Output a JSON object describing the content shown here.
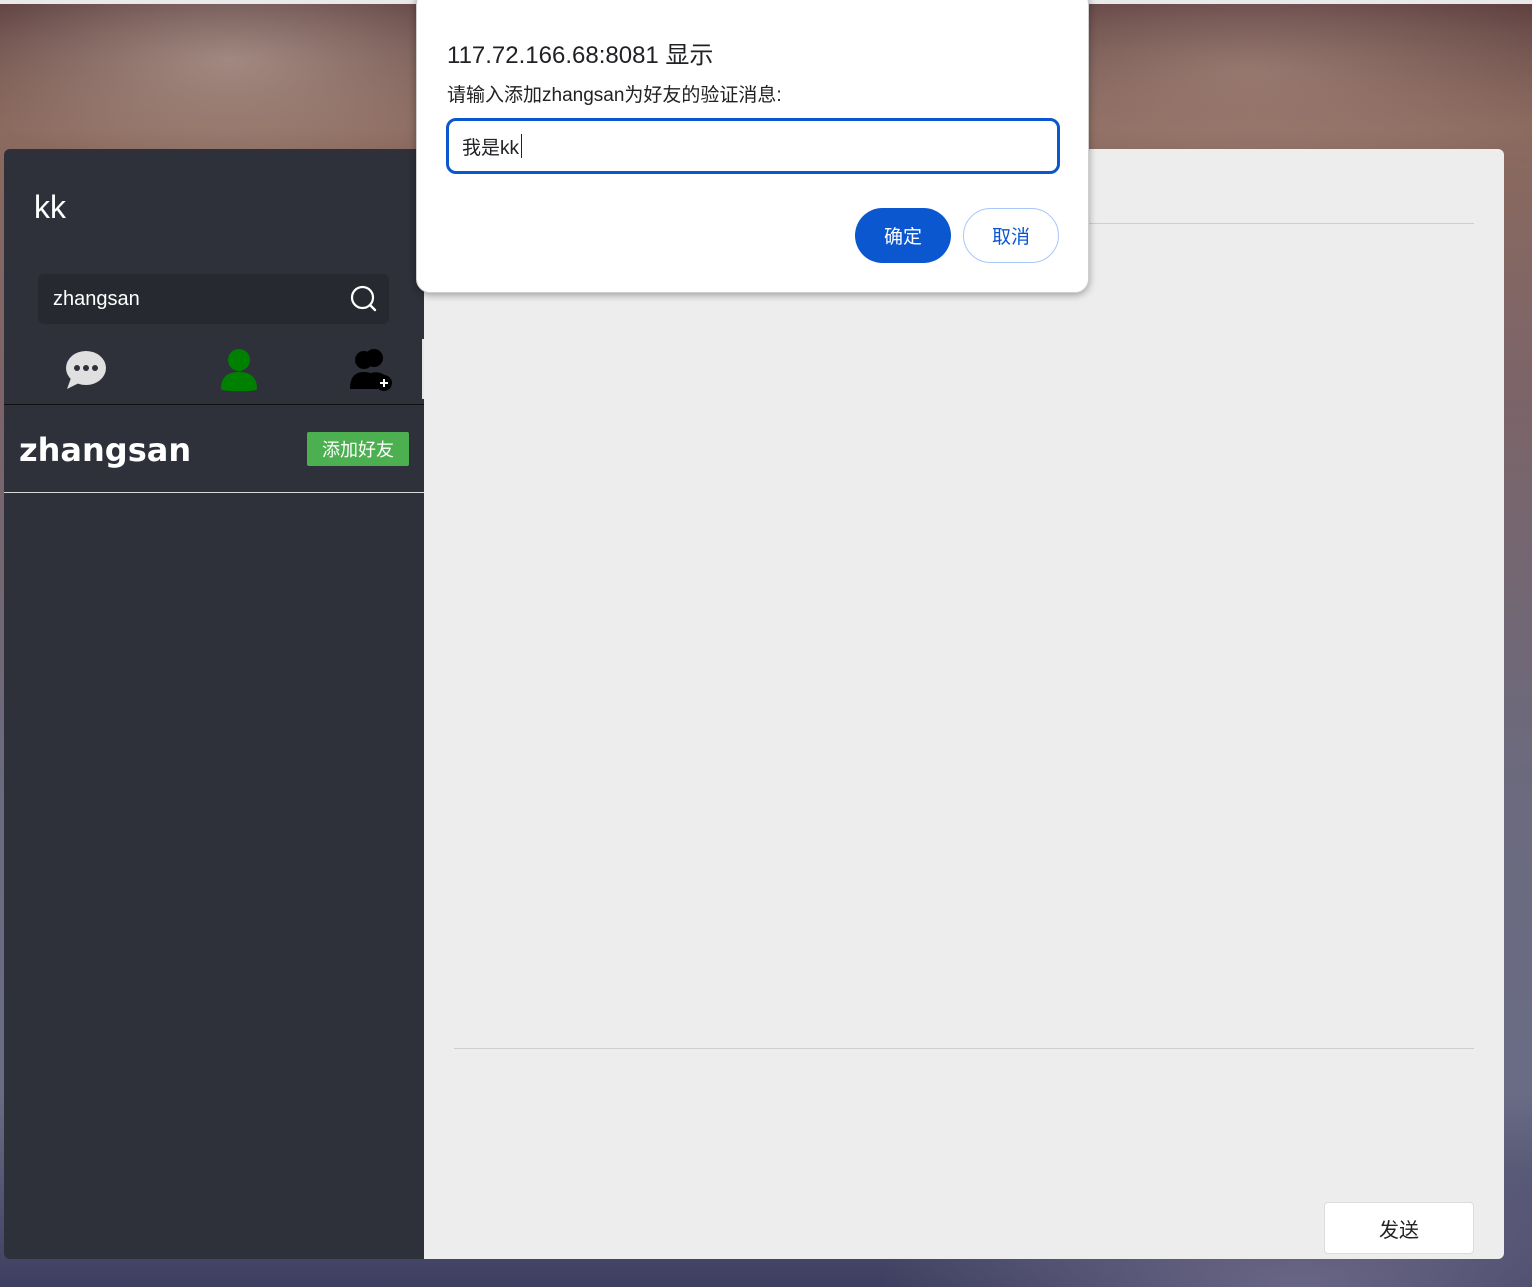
{
  "app": {
    "current_user": "kk",
    "search": {
      "value": "zhangsan"
    },
    "nav": {
      "icons": [
        "chat-bubble-icon",
        "contacts-person-icon",
        "add-friend-icon"
      ],
      "active_color": "#008000"
    },
    "search_result": {
      "name": "zhangsan",
      "add_friend_label": "添加好友",
      "button_color": "#4caf50"
    },
    "send_label": "发送"
  },
  "dialog": {
    "title": "117.72.166.68:8081 显示",
    "message": "请输入添加zhangsan为好友的验证消息:",
    "input_value": "我是kk",
    "ok_label": "确定",
    "cancel_label": "取消",
    "accent_color": "#0b57d0"
  }
}
